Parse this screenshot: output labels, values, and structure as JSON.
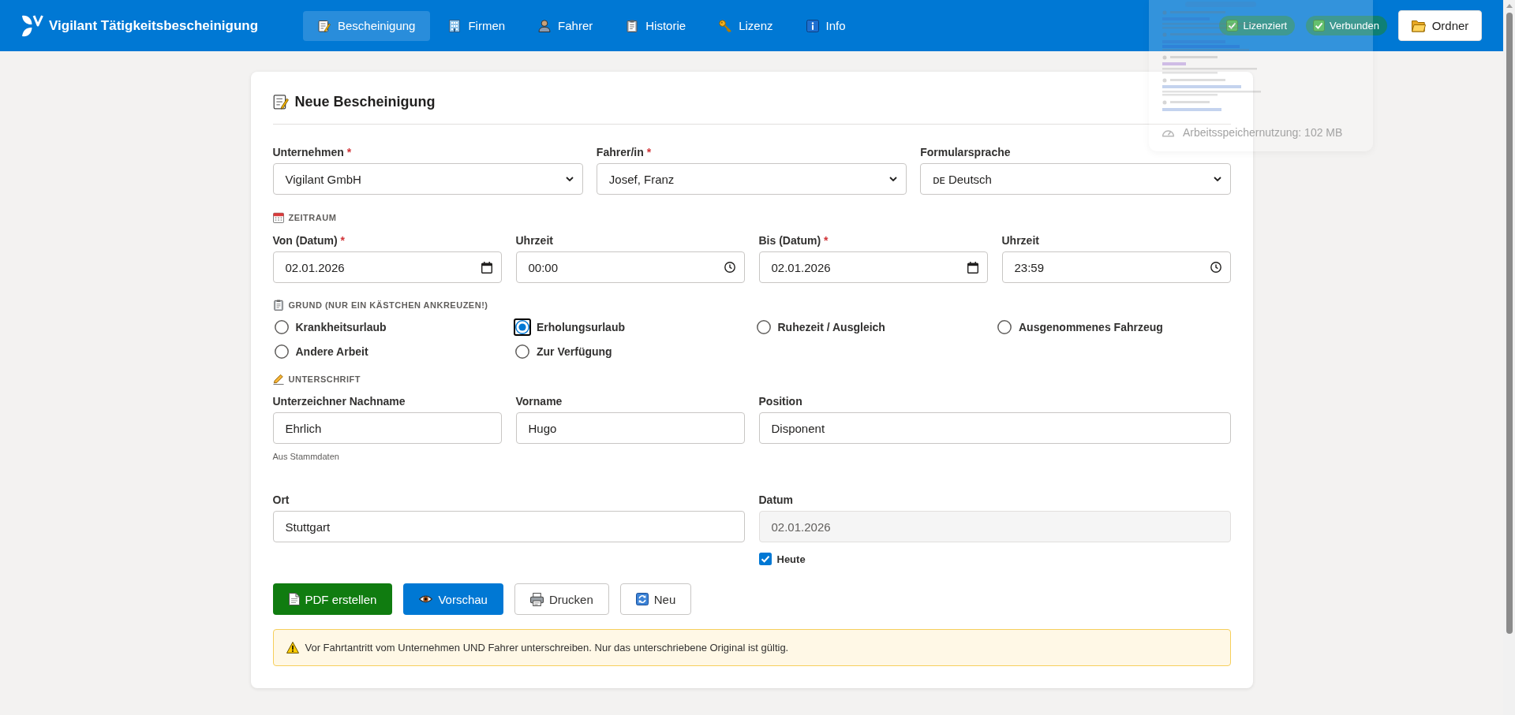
{
  "app": {
    "title": "Vigilant Tätigkeitsbescheinigung"
  },
  "nav": [
    {
      "label": "Bescheinigung",
      "selected": true
    },
    {
      "label": "Firmen",
      "selected": false
    },
    {
      "label": "Fahrer",
      "selected": false
    },
    {
      "label": "Historie",
      "selected": false
    },
    {
      "label": "Lizenz",
      "selected": false
    },
    {
      "label": "Info",
      "selected": false
    }
  ],
  "status_badges": [
    "Lizenziert",
    "Verbunden"
  ],
  "folder_button": "Ordner",
  "overlay_panel": {
    "memory_usage": "Arbeitsspeichernutzung: 102 MB"
  },
  "form": {
    "title": "Neue Bescheinigung",
    "selects": [
      {
        "label": "Unternehmen",
        "required_mark": "*",
        "value": "Vigilant GmbH"
      },
      {
        "label": "Fahrer/in",
        "required_mark": "*",
        "value": "Josef, Franz"
      },
      {
        "label": "Formularsprache",
        "value": "ᴅᴇ Deutsch"
      }
    ],
    "period": {
      "heading": "ZEITRAUM",
      "fields": [
        {
          "label": "Von (Datum)",
          "required_mark": "*",
          "kind": "date",
          "value": "02.01.2026"
        },
        {
          "label": "Uhrzeit",
          "kind": "time",
          "value": "00:00"
        },
        {
          "label": "Bis (Datum)",
          "required_mark": "*",
          "kind": "date",
          "value": "02.01.2026"
        },
        {
          "label": "Uhrzeit",
          "kind": "time",
          "value": "23:59"
        }
      ]
    },
    "reason": {
      "heading": "GRUND (NUR EIN KÄSTCHEN ANKREUZEN!)",
      "options": [
        {
          "label": "Krankheitsurlaub",
          "selected": false,
          "focused": false
        },
        {
          "label": "Erholungsurlaub",
          "selected": true,
          "focused": true
        },
        {
          "label": "Ruhezeit / Ausgleich",
          "selected": false,
          "focused": false
        },
        {
          "label": "Ausgenommenes Fahrzeug",
          "selected": false,
          "focused": false
        },
        {
          "label": "Andere Arbeit",
          "selected": false,
          "focused": false
        },
        {
          "label": "Zur Verfügung",
          "selected": false,
          "focused": false
        }
      ]
    },
    "signature": {
      "heading": "UNTERSCHRIFT",
      "fields": [
        {
          "label": "Unterzeichner Nachname",
          "value": "Ehrlich",
          "hint": "Aus Stammdaten"
        },
        {
          "label": "Vorname",
          "value": "Hugo"
        },
        {
          "label": "Position",
          "value": "Disponent"
        }
      ]
    },
    "place": {
      "label": "Ort",
      "value": "Stuttgart"
    },
    "date": {
      "label": "Datum",
      "value": "02.01.2026",
      "disabled": true,
      "today": {
        "label": "Heute",
        "checked": true
      }
    },
    "buttons": [
      {
        "label": "PDF erstellen",
        "kind": "success"
      },
      {
        "label": "Vorschau",
        "kind": "primary"
      },
      {
        "label": "Drucken",
        "kind": "default"
      },
      {
        "label": "Neu",
        "kind": "default"
      }
    ],
    "notice": "Vor Fahrtantritt vom Unternehmen UND Fahrer unterschreiben. Nur das unterschriebene Original ist gültig."
  }
}
